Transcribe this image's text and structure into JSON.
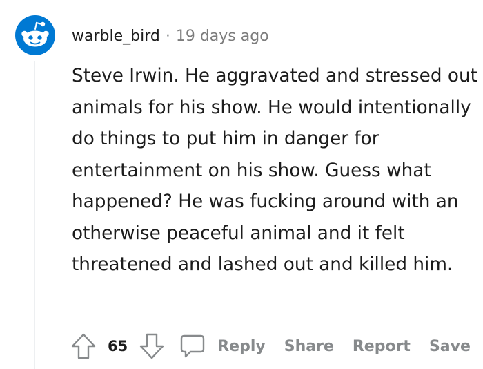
{
  "comment": {
    "username": "warble_bird",
    "separator": "·",
    "time_ago": "19 days ago",
    "avatar": "reddit-snoo-avatar",
    "body": "Steve Irwin. He aggravated and stressed out animals for his show. He would intentionally do things to put him in danger for entertainment on his show. Guess what happened? He was fucking around with an otherwise peaceful animal and it felt threatened and lashed out and killed him.",
    "score": "65",
    "actions": {
      "reply": "Reply",
      "share": "Share",
      "report": "Report",
      "save": "Save"
    }
  },
  "colors": {
    "avatar_blue": "#0079d3",
    "text": "#1c1c1c",
    "meta": "#7c7c7c",
    "action": "#878a8c",
    "thread_line": "#edeff1"
  },
  "icons": [
    "upvote-arrow-icon",
    "downvote-arrow-icon",
    "comment-bubble-icon"
  ]
}
